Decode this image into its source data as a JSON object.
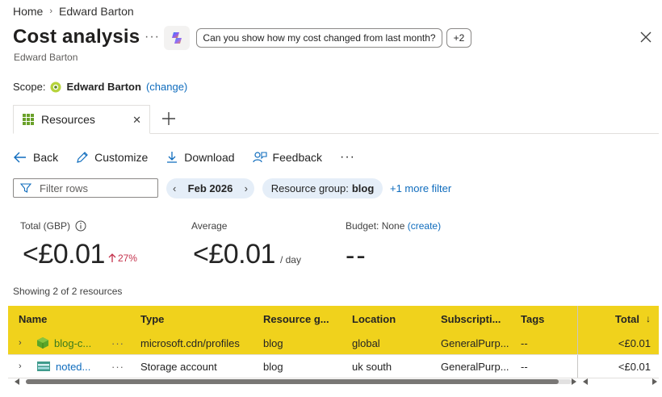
{
  "breadcrumb": {
    "home": "Home",
    "current": "Edward Barton"
  },
  "header": {
    "title": "Cost analysis",
    "subtitle": "Edward Barton",
    "more": "···",
    "prompt_pill": "Can you show how my cost changed from last month?",
    "more_prompts": "+2"
  },
  "scope": {
    "label": "Scope:",
    "name": "Edward Barton",
    "change_link": "(change)"
  },
  "tabs": [
    {
      "label": "Resources",
      "icon": "grid-icon"
    }
  ],
  "toolbar": {
    "back": "Back",
    "customize": "Customize",
    "download": "Download",
    "feedback": "Feedback",
    "more": "···"
  },
  "filters": {
    "filter_placeholder": "Filter rows",
    "date": "Feb 2026",
    "resource_group_label": "Resource group:",
    "resource_group_value": "blog",
    "more_filter": "+1 more filter"
  },
  "kpis": {
    "total_label": "Total (GBP)",
    "total_value": "<£0.01",
    "total_change": "27%",
    "average_label": "Average",
    "average_value": "<£0.01",
    "average_unit": "/ day",
    "budget_label": "Budget: None",
    "budget_link": "(create)",
    "budget_value": "--"
  },
  "table": {
    "showing": "Showing 2 of 2 resources",
    "columns": {
      "name": "Name",
      "type": "Type",
      "resource_group": "Resource g...",
      "location": "Location",
      "subscription": "Subscripti...",
      "tags": "Tags",
      "total": "Total"
    },
    "rows": [
      {
        "name": "blog-c...",
        "icon": "cdn-profile-icon",
        "type": "microsoft.cdn/profiles",
        "resource_group": "blog",
        "location": "global",
        "subscription": "GeneralPurp...",
        "tags": "--",
        "total": "<£0.01",
        "highlighted": true
      },
      {
        "name": "noted...",
        "icon": "storage-account-icon",
        "type": "Storage account",
        "resource_group": "blog",
        "location": "uk south",
        "subscription": "GeneralPurp...",
        "tags": "--",
        "total": "<£0.01",
        "highlighted": false
      }
    ]
  },
  "colors": {
    "accent": "#0f6cbd",
    "highlight": "#f0d21c",
    "increase": "#c4314b"
  }
}
